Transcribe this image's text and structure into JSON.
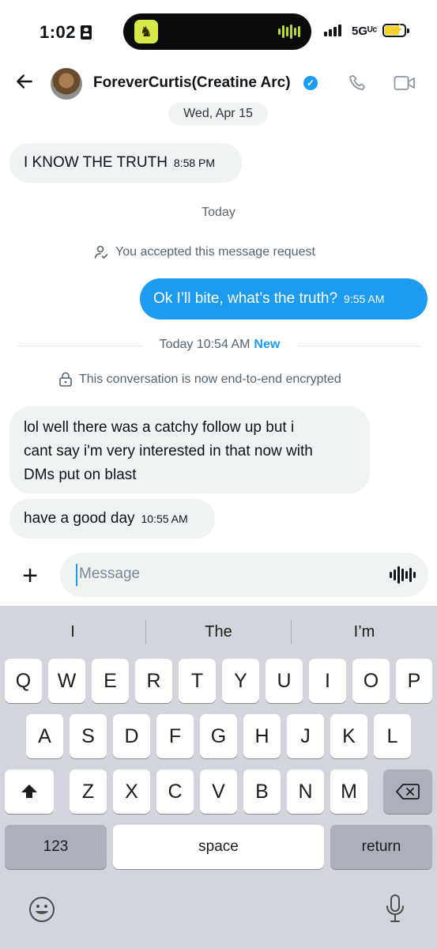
{
  "status_bar": {
    "time": "1:02",
    "network": "5Gᵁᶜ",
    "icons": [
      "id-card-icon",
      "signal-icon",
      "battery-charging-icon"
    ]
  },
  "header": {
    "contact_name": "ForeverCurtis(Creatine Arc)",
    "verified": true,
    "icons": [
      "back-arrow-icon",
      "phone-icon",
      "video-call-icon"
    ]
  },
  "conversation": {
    "date_pill": "Wed, Apr 15",
    "messages": [
      {
        "direction": "in",
        "text": "I KNOW THE TRUTH",
        "time": "8:58 PM"
      },
      {
        "direction": "out",
        "text": "Ok I’ll bite, what’s the truth?",
        "time": "9:55 AM"
      },
      {
        "direction": "in",
        "text_lines": [
          "lol well there was a catchy follow up but i",
          "cant say i'm very interested in that now with",
          "DMs put on blast"
        ]
      },
      {
        "direction": "in",
        "text": "have a good day",
        "time": "10:55 AM"
      }
    ],
    "today_label": "Today",
    "accepted_notice": "You accepted this message request",
    "divider": {
      "label": "Today 10:54 AM",
      "badge": "New"
    },
    "encryption_notice": "This conversation is now end-to-end encrypted"
  },
  "composer": {
    "placeholder": "Message",
    "icons": [
      "plus-icon",
      "voice-message-icon"
    ]
  },
  "keyboard": {
    "suggestions": [
      "I",
      "The",
      "I’m"
    ],
    "row1": [
      "Q",
      "W",
      "E",
      "R",
      "T",
      "Y",
      "U",
      "I",
      "O",
      "P"
    ],
    "row2": [
      "A",
      "S",
      "D",
      "F",
      "G",
      "H",
      "J",
      "K",
      "L"
    ],
    "row3": [
      "Z",
      "X",
      "C",
      "V",
      "B",
      "N",
      "M"
    ],
    "numbers_key": "123",
    "space_key": "space",
    "return_key": "return",
    "icons": [
      "shift-icon",
      "backspace-icon",
      "emoji-icon",
      "microphone-icon"
    ]
  },
  "colors": {
    "accent": "#1d9bf0",
    "bubble_in": "#eff3f4",
    "keyboard_bg": "#d2d5db"
  }
}
